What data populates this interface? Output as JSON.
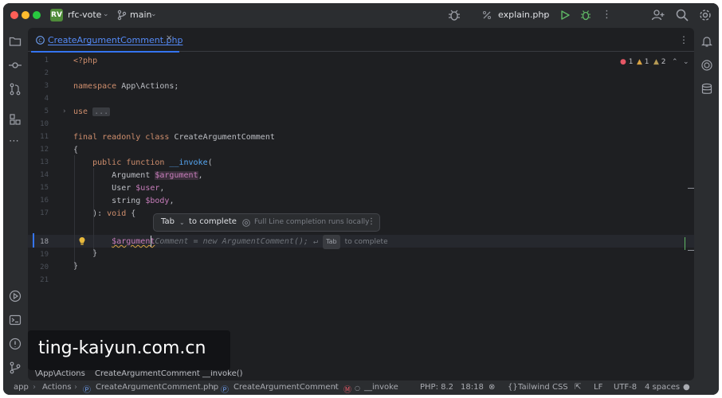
{
  "titlebar": {
    "project_badge": "RV",
    "project_name": "rfc-vote",
    "branch": "main",
    "run_config": "explain.php"
  },
  "editor": {
    "tab_label": "CreateArgumentComment.php",
    "inspections": {
      "errors": "1",
      "weak_warnings": "1",
      "warnings": "2"
    },
    "line_numbers": [
      "1",
      "2",
      "3",
      "4",
      "5",
      "10",
      "11",
      "12",
      "13",
      "14",
      "15",
      "16",
      "17",
      "18",
      "19",
      "20",
      "21"
    ],
    "current_line": "18"
  },
  "code": {
    "l1": "<?php",
    "l3_kw": "namespace",
    "l3_rest": " App\\Actions;",
    "l5_kw": "use",
    "l5_fold": "...",
    "l10_kw": "final readonly class",
    "l10_rest": " CreateArgumentComment",
    "l11": "{",
    "l12_kw": "public function",
    "l12_fn": " __invoke",
    "l12_rest": "(",
    "l13_type": "Argument ",
    "l13_var": "$argument",
    "l13_rest": ",",
    "l14_type": "User ",
    "l14_var": "$user",
    "l14_rest": ",",
    "l15_type": "string ",
    "l15_var": "$body",
    "l15_rest": ",",
    "l16_a": "): ",
    "l16_kw": "void",
    "l16_b": " {",
    "l18_typed": "$argument",
    "l18_ghost": "Comment = new ArgumentComment();",
    "l19": "}",
    "l20": "}"
  },
  "completion": {
    "key": "Tab",
    "action": "to complete",
    "note": "Full Line completion runs locally",
    "inline_key": "Tab",
    "inline_action": "to complete"
  },
  "breadcrumbs": {
    "namespace": "\\App\\Actions",
    "class": "CreateArgumentComment",
    "method": "__invoke()"
  },
  "watermark": "ting-kaiyun.com.cn",
  "statusbar": {
    "path_root": "app",
    "path_dir": "Actions",
    "path_file": "CreateArgumentComment.php",
    "path_class": "CreateArgumentComment",
    "path_method": "__invoke",
    "php_version": "PHP: 8.2",
    "position": "18:18",
    "framework": "Tailwind CSS",
    "line_sep": "LF",
    "encoding": "UTF-8",
    "indent": "4 spaces"
  },
  "colors": {
    "accent": "#3574f0",
    "keyword": "#cf8e6d",
    "function": "#56a8f5",
    "variable": "#c77dbb",
    "editor_bg": "#1e1f22",
    "chrome_bg": "#2b2d30"
  }
}
